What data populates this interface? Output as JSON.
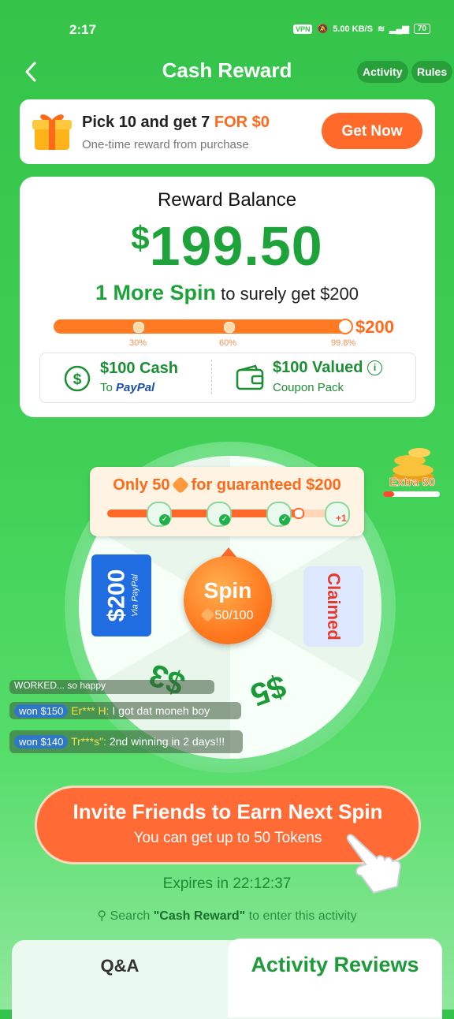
{
  "status_bar": {
    "time": "2:17",
    "vpn": "VPN",
    "net_speed": "5.00 KB/S",
    "battery": "70"
  },
  "header": {
    "title": "Cash Reward",
    "activity_label": "Activity",
    "rules_label": "Rules"
  },
  "promo": {
    "title_prefix": "Pick 10 and get 7 ",
    "title_highlight": "FOR $0",
    "subtitle": "One-time reward from purchase",
    "button": "Get Now"
  },
  "reward": {
    "title": "Reward Balance",
    "currency": "$",
    "amount": "199.50",
    "more_spin_bold": "1 More Spin",
    "more_spin_rest": " to surely get $200",
    "progress_goal": "$200",
    "progress_fraction": 0.998,
    "milestones": [
      "30%",
      "60%",
      "99.8%"
    ],
    "option1_title": "$100 Cash",
    "option1_to": "To ",
    "option1_brand": "PayPal",
    "option2_title": "$100 Valued",
    "option2_sub": "Coupon Pack"
  },
  "wheel": {
    "guarantee_prefix": "Only 50 ",
    "guarantee_suffix": " for guaranteed $200",
    "guarantee_end_label": "+1",
    "spin_label": "Spin",
    "spin_count": "50/100",
    "paypal_amount": "$200",
    "paypal_via": "Via PayPal",
    "claimed": "Claimed",
    "slice_dollars_left": "$3",
    "slice_dollars_right": "$5",
    "extra_label": "Extra 50"
  },
  "feed": {
    "partial_top": "WORKED... so happy",
    "items": [
      {
        "badge": "won $150",
        "user": "Er*** H:",
        "msg": " I got dat moneh boy"
      },
      {
        "badge": "won $140",
        "user": "Tr***s\":",
        "msg": " 2nd winning in 2 days!!!"
      }
    ]
  },
  "invite": {
    "title": "Invite Friends to Earn Next Spin",
    "subtitle": "You can get up to 50 Tokens"
  },
  "expires": "Expires in 22:12:37",
  "search_hint": {
    "prefix": "Search ",
    "keyword": "\"Cash Reward\"",
    "suffix": " to enter this activity"
  },
  "tabs": {
    "qa": "Q&A",
    "reviews": "Activity Reviews"
  },
  "colors": {
    "brand_green": "#35c34a",
    "accent_orange": "#ff6a2a",
    "paypal_blue": "#1f6de0"
  }
}
